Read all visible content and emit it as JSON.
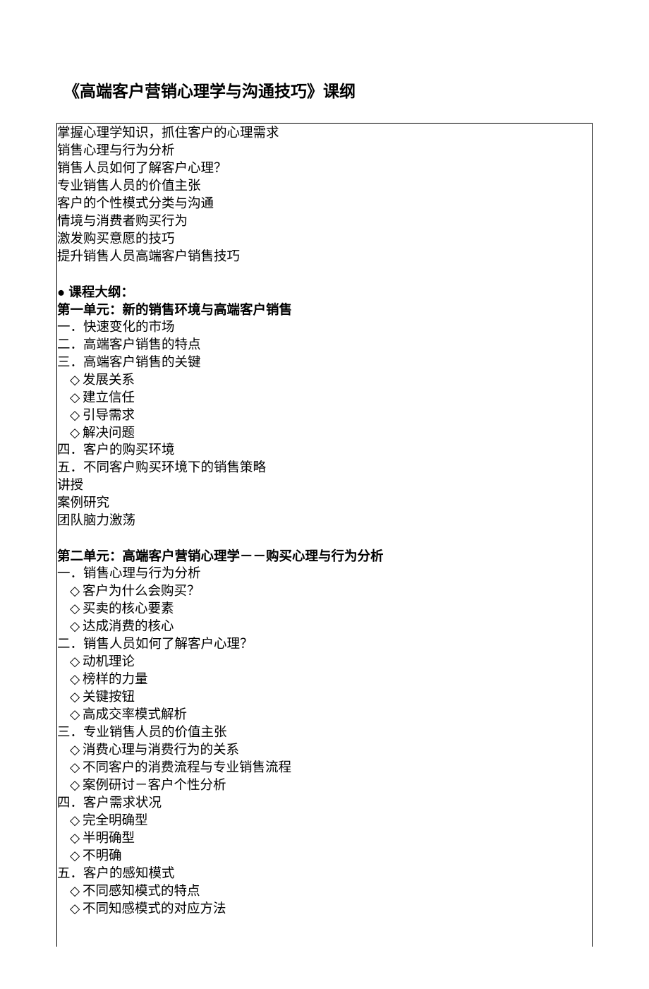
{
  "title": "《高端客户营销心理学与沟通技巧》课纲",
  "intro": {
    "lines": [
      "掌握心理学知识，抓住客户的心理需求",
      "销售心理与行为分析",
      "销售人员如何了解客户心理？",
      "专业销售人员的价值主张",
      "客户的个性模式分类与沟通",
      "情境与消费者购买行为",
      "激发购买意愿的技巧",
      "提升销售人员高端客户销售技巧"
    ]
  },
  "outline_header": "● 课程大纲：",
  "unit1": {
    "header": "第一单元：新的销售环境与高端客户销售",
    "items": [
      "一．快速变化的市场",
      "二．高端客户销售的特点",
      "三．高端客户销售的关键"
    ],
    "sub3": [
      "发展关系",
      "建立信任",
      "引导需求",
      "解决问题"
    ],
    "items2": [
      "四．客户的购买环境",
      "五．不同客户购买环境下的销售策略",
      "讲授",
      "案例研究",
      "团队脑力激荡"
    ]
  },
  "unit2": {
    "header": "第二单元：高端客户营销心理学－－购买心理与行为分析",
    "s1": {
      "h": "一．销售心理与行为分析",
      "items": [
        "客户为什么会购买？",
        "买卖的核心要素",
        "达成消费的核心"
      ]
    },
    "s2": {
      "h": "二．销售人员如何了解客户心理？",
      "items": [
        "动机理论",
        "榜样的力量",
        "关键按钮",
        "高成交率模式解析"
      ]
    },
    "s3": {
      "h": "三．专业销售人员的价值主张",
      "items": [
        "消费心理与消费行为的关系",
        "不同客户的消费流程与专业销售流程",
        "案例研讨－客户个性分析"
      ]
    },
    "s4": {
      "h": "四．客户需求状况",
      "items": [
        "完全明确型",
        "半明确型",
        "不明确"
      ]
    },
    "s5": {
      "h": "五．客户的感知模式",
      "items": [
        "不同感知模式的特点",
        "不同知感模式的对应方法"
      ]
    }
  }
}
